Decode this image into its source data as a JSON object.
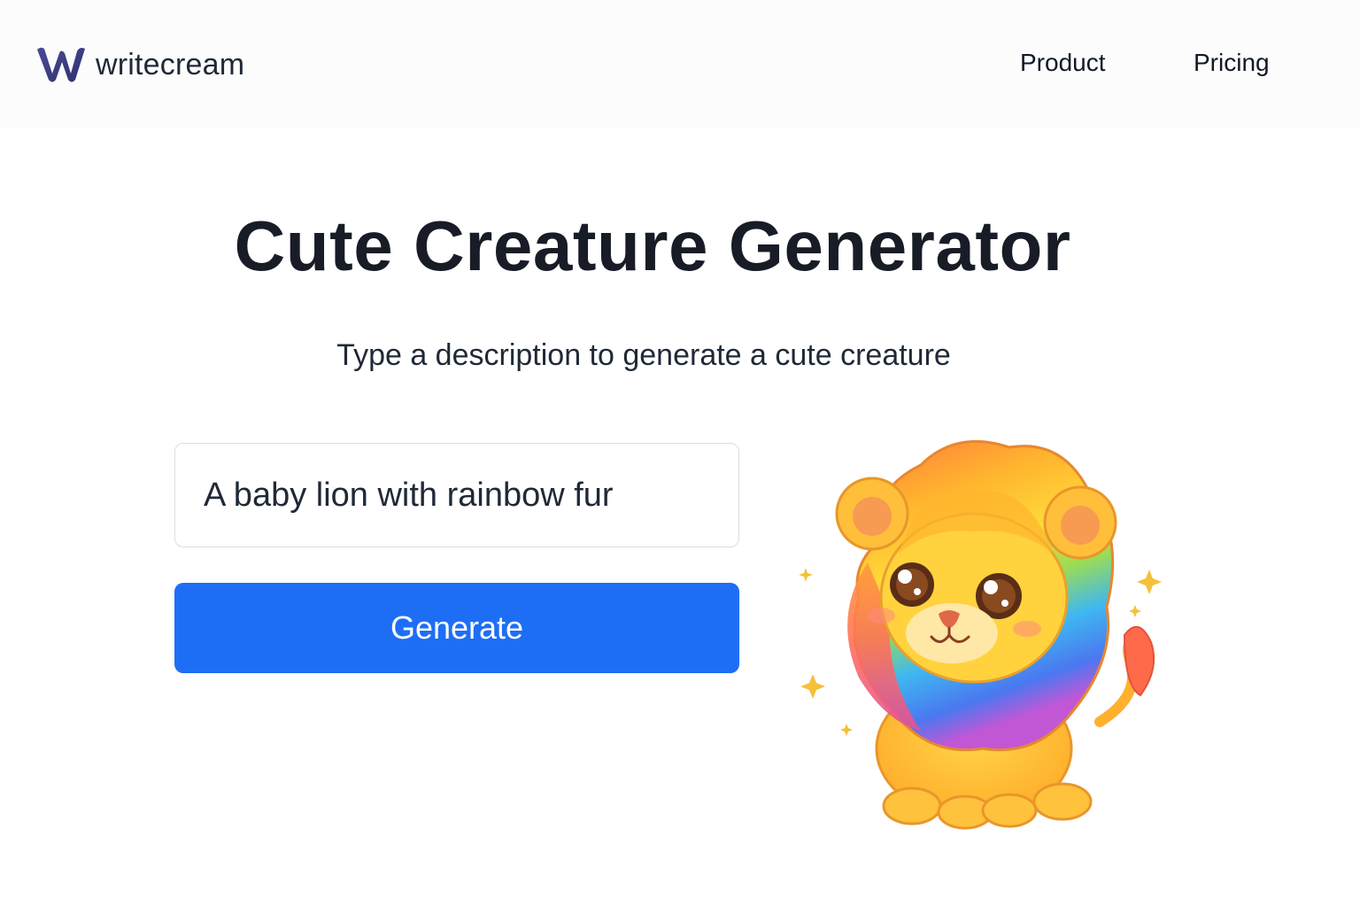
{
  "header": {
    "brand": "writecream",
    "brand_color": "#3b3e84",
    "logo_icon": "writecream-w-logo-icon",
    "nav": {
      "product": "Product",
      "pricing": "Pricing"
    }
  },
  "main": {
    "title": "Cute Creature Generator",
    "subtitle": "Type a description to generate a cute creature",
    "prompt_value": "A baby lion with rainbow fur",
    "generate_label": "Generate",
    "button_color": "#1e6ef5",
    "result_image": "baby-lion-rainbow-fur-illustration"
  }
}
